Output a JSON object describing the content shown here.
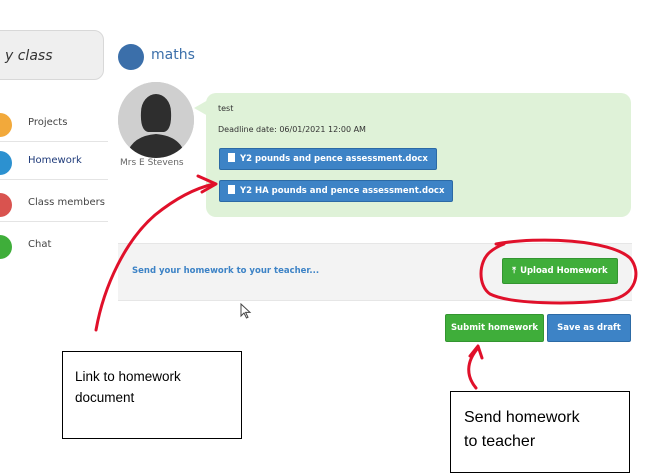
{
  "sidebar": {
    "my_class_label": "y class",
    "items": [
      {
        "label": "Projects",
        "color": "#f2a93b"
      },
      {
        "label": "Homework",
        "color": "#2c91d0"
      },
      {
        "label": "Class members",
        "color": "#d9534f"
      },
      {
        "label": "Chat",
        "color": "#3fae3a"
      }
    ]
  },
  "class": {
    "name": "maths",
    "color": "#3b6faa"
  },
  "post": {
    "teacher_name": "Mrs E Stevens",
    "message": "test",
    "deadline": "Deadline date: 06/01/2021 12:00 AM",
    "attachments": [
      {
        "label": "Y2 pounds and pence assessment.docx"
      },
      {
        "label": "Y2 HA pounds and pence assessment.docx"
      }
    ],
    "bubble_color": "#dff2d8"
  },
  "upload": {
    "prompt": "Send your homework to your teacher...",
    "upload_label": "Upload Homework"
  },
  "actions": {
    "submit_label": "Submit homework",
    "draft_label": "Save as draft"
  },
  "annotations": {
    "link_note_line1": "Link to homework",
    "link_note_line2": "document",
    "send_note_line1": "Send homework",
    "send_note_line2": "to teacher",
    "annotation_color": "#e0102a"
  }
}
